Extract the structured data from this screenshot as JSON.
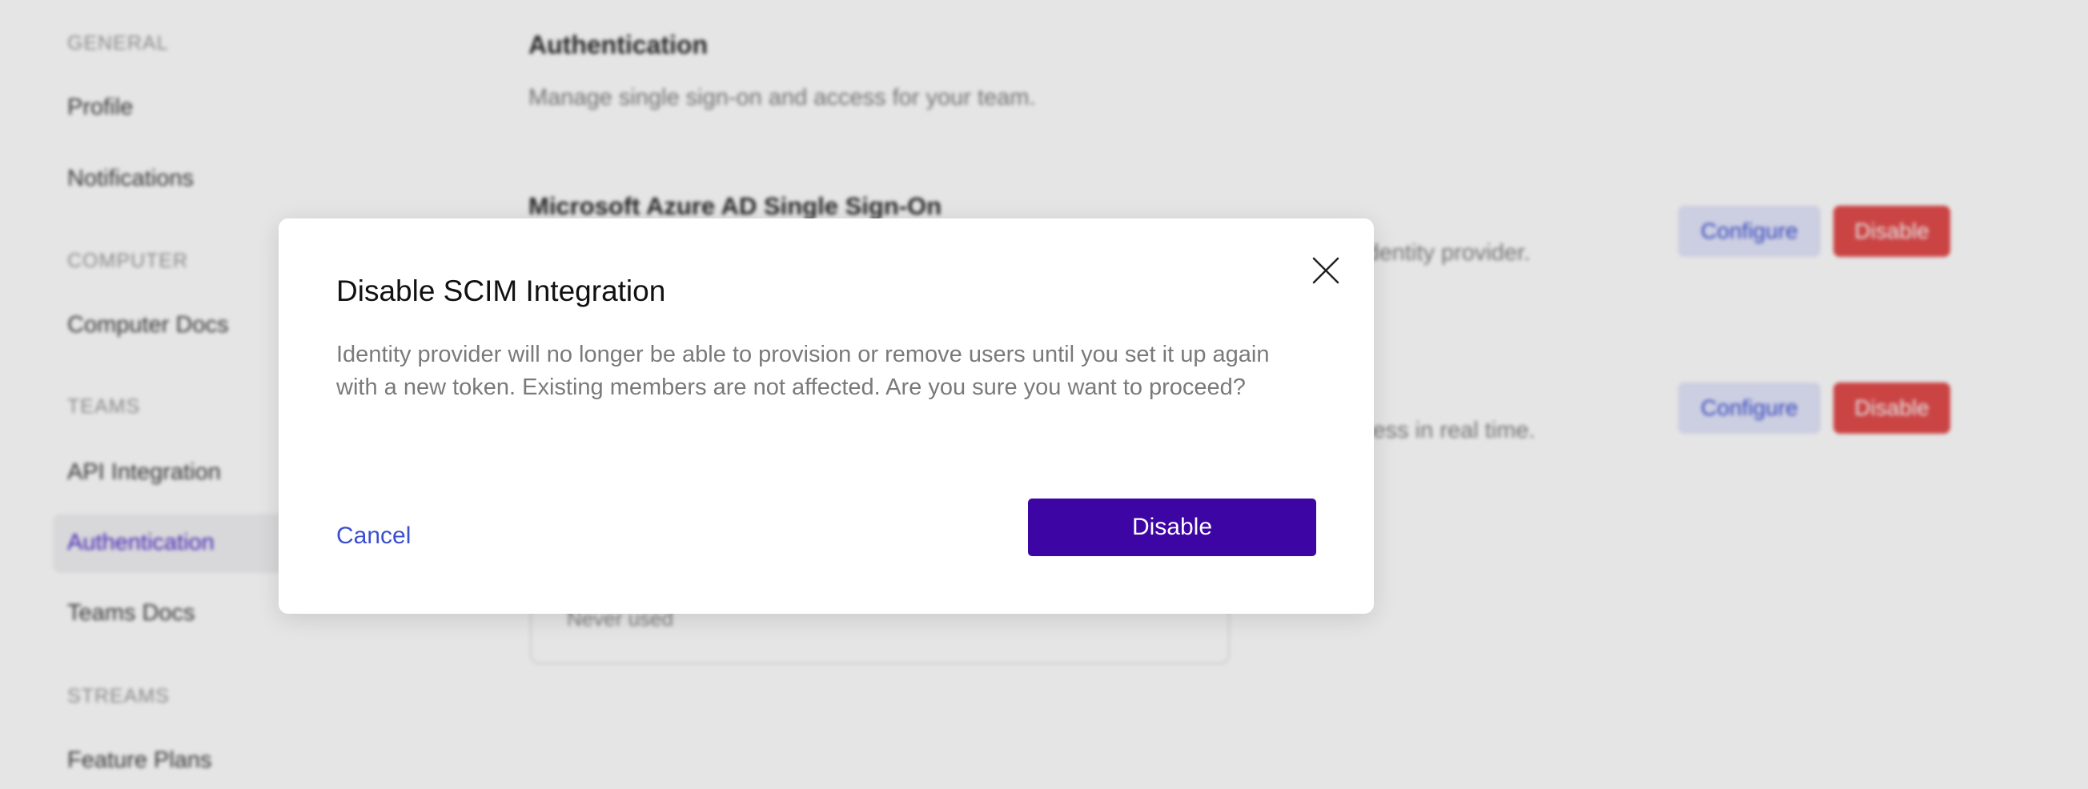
{
  "sidebar": {
    "sections": [
      {
        "label": "GENERAL",
        "items": [
          {
            "label": "Profile"
          },
          {
            "label": "Notifications"
          }
        ]
      },
      {
        "label": "COMPUTER",
        "items": [
          {
            "label": "Computer Docs"
          }
        ]
      },
      {
        "label": "TEAMS",
        "items": [
          {
            "label": "API Integration"
          },
          {
            "label": "Authentication"
          },
          {
            "label": "Teams Docs"
          }
        ]
      },
      {
        "label": "STREAMS",
        "items": [
          {
            "label": "Feature Plans"
          }
        ]
      }
    ],
    "active_item": "Authentication"
  },
  "main": {
    "title": "Authentication",
    "subtitle": "Manage single sign-on and access for your team.",
    "rows": [
      {
        "title": "Microsoft Azure AD Single Sign-On",
        "description_visible": "identity provider.",
        "configure_label": "Configure",
        "disable_label": "Disable"
      },
      {
        "description_visible": "cess in real time.",
        "configure_label": "Configure",
        "disable_label": "Disable"
      }
    ],
    "token_card": {
      "status": "Never used"
    }
  },
  "modal": {
    "title": "Disable SCIM Integration",
    "body": "Identity provider will no longer be able to provision or remove users until you set it up again with a new token. Existing members are not affected. Are you sure you want to proceed?",
    "cancel_label": "Cancel",
    "confirm_label": "Disable",
    "close_icon": "close-icon"
  },
  "colors": {
    "accent": "#3d05a3",
    "link": "#3b4fcf",
    "danger": "#e34c4c",
    "sidebar_active": "#4a28c9"
  }
}
